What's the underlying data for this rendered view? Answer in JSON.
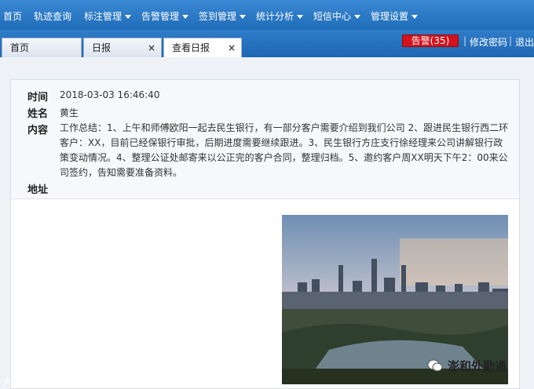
{
  "nav": {
    "items": [
      {
        "label": "首页",
        "caret": false
      },
      {
        "label": "轨迹查询",
        "caret": false
      },
      {
        "label": "标注管理",
        "caret": true
      },
      {
        "label": "告警管理",
        "caret": true
      },
      {
        "label": "签到管理",
        "caret": true
      },
      {
        "label": "统计分析",
        "caret": true
      },
      {
        "label": "短信中心",
        "caret": true
      },
      {
        "label": "管理设置",
        "caret": true
      }
    ]
  },
  "tabs": [
    {
      "label": "首页"
    },
    {
      "label": "日报"
    },
    {
      "label": "查看日报"
    }
  ],
  "close_glyph": "×",
  "alarm_label": "告警(35)",
  "links": {
    "change_password": "修改密码",
    "logout": "退出",
    "separator": "|"
  },
  "report": {
    "time_label": "时间",
    "time_value": "2018-03-03 16:46:40",
    "name_label": "姓名",
    "name_value": "黄生",
    "content_label": "内容",
    "content_value": "工作总结：1、上午和师傅欧阳一起去民生银行，有一部分客户需要介绍到我们公司 2、跟进民生银行西二环客户：XX，目前已经保银行审批，后期进度需要继续跟进。3、民生银行方庄支行徐经理来公司讲解银行政策变动情况。4、整理公证处邮寄来以公正完的客户合同，整理归档。5、邀约客户周XX明天下午2：00来公司签约，告知需要准备资料。",
    "address_label": "地址"
  },
  "watermarks": {
    "left": "大数跨境",
    "right": "澎和外勤通"
  },
  "colors": {
    "nav_bg": "#1f6cb8",
    "alarm_bg": "#d3121c"
  }
}
